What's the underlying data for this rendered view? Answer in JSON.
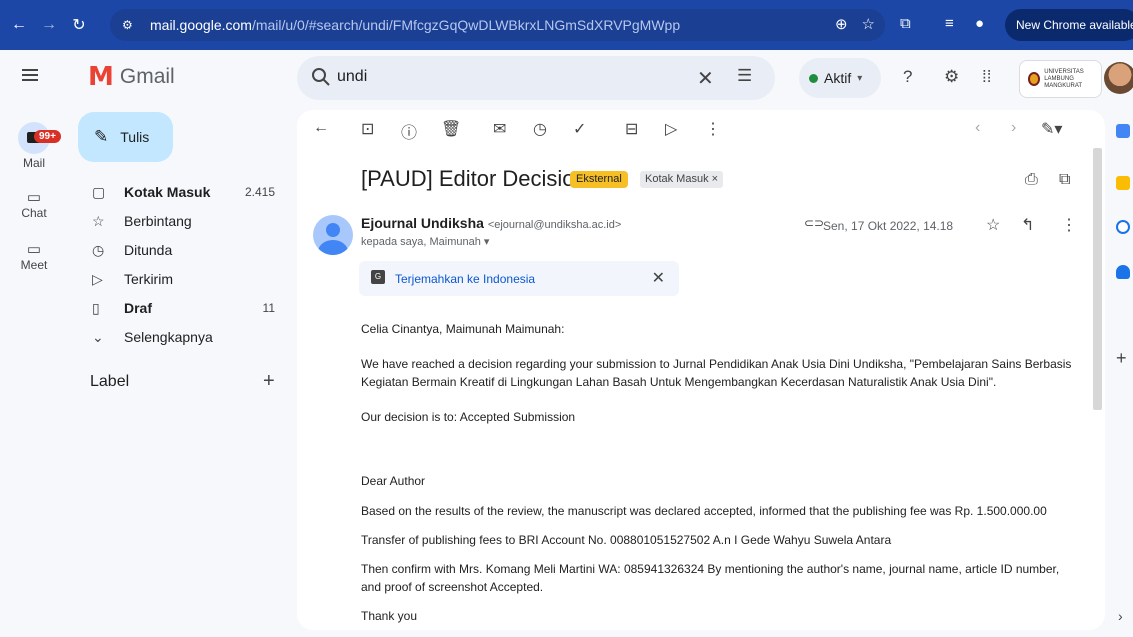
{
  "browser": {
    "url_host": "mail.google.com",
    "url_path": "/mail/u/0/#search/undi/FMfcgzGqQwDLWBkrxLNGmSdXRVPgMWpp",
    "update_label": "New Chrome available"
  },
  "app": {
    "name": "Gmail"
  },
  "search": {
    "query": "undi"
  },
  "status": {
    "label": "Aktif"
  },
  "rail": {
    "badge": "99+",
    "items": [
      {
        "label": "Mail"
      },
      {
        "label": "Chat"
      },
      {
        "label": "Meet"
      }
    ]
  },
  "compose": {
    "label": "Tulis"
  },
  "nav": [
    {
      "label": "Kotak Masuk",
      "count": "2.415",
      "icon": "inbox-icon"
    },
    {
      "label": "Berbintang",
      "count": "",
      "icon": "star-icon"
    },
    {
      "label": "Ditunda",
      "count": "",
      "icon": "clock-icon"
    },
    {
      "label": "Terkirim",
      "count": "",
      "icon": "send-icon"
    },
    {
      "label": "Draf",
      "count": "11",
      "icon": "draft-icon"
    },
    {
      "label": "Selengkapnya",
      "count": "",
      "icon": "chevron-down-icon"
    }
  ],
  "labels": {
    "title": "Label"
  },
  "org": {
    "logo_text_1": "UNIVERSITAS",
    "logo_text_2": "LAMBUNG MANGKURAT"
  },
  "email": {
    "subject": "[PAUD] Editor Decision",
    "chip_external": "Eksternal",
    "chip_inbox": "Kotak Masuk ×",
    "sender_name": "Ejournal Undiksha",
    "sender_email": "<ejournal@undiksha.ac.id>",
    "to": "kepada saya, Maimunah ▾",
    "datetime": "Sen, 17 Okt 2022, 14.18",
    "translate": "Terjemahkan ke Indonesia",
    "body": [
      "Celia Cinantya, Maimunah Maimunah:",
      "We have reached a decision regarding your submission to Jurnal Pendidikan Anak Usia Dini Undiksha, \"Pembelajaran Sains Berbasis Kegiatan Bermain Kreatif di Lingkungan Lahan Basah Untuk Mengembangkan Kecerdasan Naturalistik Anak Usia Dini\".",
      "Our decision is to: Accepted Submission",
      "Dear Author",
      "Based on the results of the review, the manuscript was declared accepted, informed that the publishing fee was Rp. 1.500.000.00",
      "Transfer of publishing fees to BRI Account No. 008801051527502 A.n I Gede Wahyu Suwela Antara",
      "Then confirm with Mrs. Komang Meli Martini WA: 085941326324 By mentioning the author's name, journal name, article ID number, and proof of screenshot Accepted.",
      "Thank you"
    ]
  }
}
